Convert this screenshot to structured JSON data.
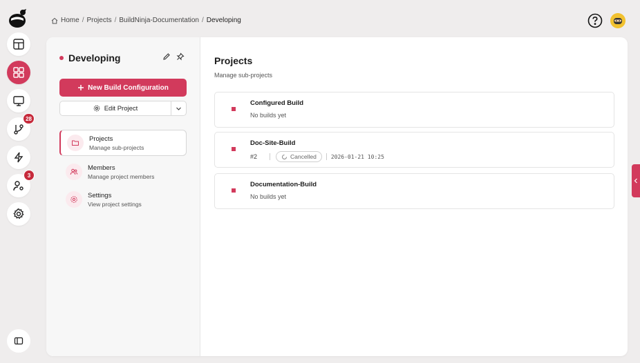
{
  "breadcrumb": {
    "items": [
      "Home",
      "Projects",
      "BuildNinja-Documentation",
      "Developing"
    ],
    "separator": "/"
  },
  "rail": {
    "badges": {
      "vcs": "28",
      "agents": "3"
    },
    "accent_color": "#d23a5c"
  },
  "sidebar": {
    "project_name": "Developing",
    "new_build_label": "New Build Configuration",
    "edit_project_label": "Edit Project",
    "nav": [
      {
        "label": "Projects",
        "description": "Manage sub-projects",
        "icon": "folder-icon"
      },
      {
        "label": "Members",
        "description": "Manage project members",
        "icon": "users-icon"
      },
      {
        "label": "Settings",
        "description": "View project settings",
        "icon": "gear-icon"
      }
    ]
  },
  "main": {
    "title": "Projects",
    "subtitle": "Manage sub-projects",
    "projects": [
      {
        "name": "Configured Build",
        "meta": "No builds yet"
      },
      {
        "name": "Doc-Site-Build",
        "build_number": "#2",
        "status": "Cancelled",
        "timestamp": "2026-01-21 10:25"
      },
      {
        "name": "Documentation-Build",
        "meta": "No builds yet"
      }
    ]
  }
}
